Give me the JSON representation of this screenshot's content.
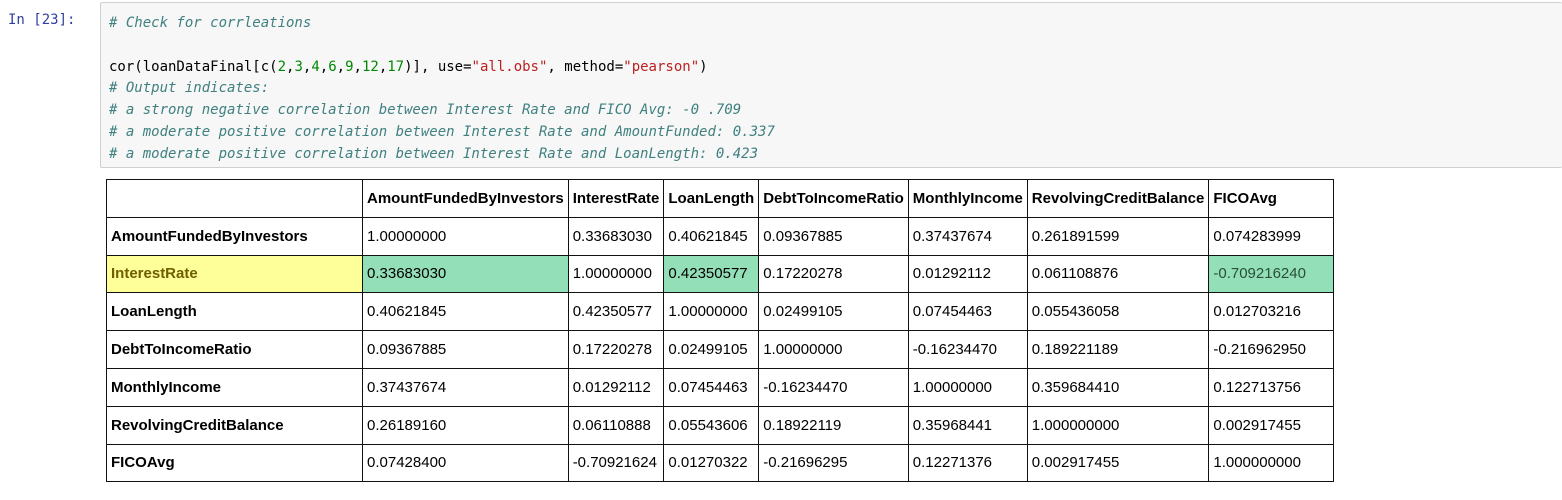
{
  "cell": {
    "prompt": "In [23]:",
    "code": {
      "comment_header": "# Check for corrleations",
      "call_prefix": "cor(loanDataFinal[c(",
      "call_nums": [
        "2",
        "3",
        "4",
        "6",
        "9",
        "12",
        "17"
      ],
      "call_mid1": ")], use=",
      "use_value": "\"all.obs\"",
      "call_mid2": ", method=",
      "method_value": "\"pearson\"",
      "call_suffix": ")",
      "comments": [
        "# Output indicates:",
        "# a strong negative correlation between Interest Rate and FICO Avg: -0 .709",
        "# a moderate positive correlation between Interest Rate and AmountFunded: 0.337",
        "# a moderate positive correlation between Interest Rate and LoanLength: 0.423"
      ]
    }
  },
  "table": {
    "columns": [
      "",
      "AmountFundedByInvestors",
      "InterestRate",
      "LoanLength",
      "DebtToIncomeRatio",
      "MonthlyIncome",
      "RevolvingCreditBalance",
      "FICOAvg"
    ],
    "rows": [
      {
        "label": "AmountFundedByInvestors",
        "cells": [
          "1.00000000",
          "0.33683030",
          "0.40621845",
          "0.09367885",
          "0.37437674",
          "0.261891599",
          "0.074283999"
        ]
      },
      {
        "label": "InterestRate",
        "cells": [
          "0.33683030",
          "1.00000000",
          "0.42350577",
          "0.17220278",
          "0.01292112",
          "0.061108876",
          "-0.709216240"
        ]
      },
      {
        "label": "LoanLength",
        "cells": [
          "0.40621845",
          "0.42350577",
          "1.00000000",
          "0.02499105",
          "0.07454463",
          "0.055436058",
          "0.012703216"
        ]
      },
      {
        "label": "DebtToIncomeRatio",
        "cells": [
          "0.09367885",
          "0.17220278",
          "0.02499105",
          "1.00000000",
          "-0.16234470",
          "0.189221189",
          "-0.216962950"
        ]
      },
      {
        "label": "MonthlyIncome",
        "cells": [
          "0.37437674",
          "0.01292112",
          "0.07454463",
          "-0.16234470",
          "1.00000000",
          "0.359684410",
          "0.122713756"
        ]
      },
      {
        "label": "RevolvingCreditBalance",
        "cells": [
          "0.26189160",
          "0.06110888",
          "0.05543606",
          "0.18922119",
          "0.35968441",
          "1.000000000",
          "0.002917455"
        ]
      },
      {
        "label": "FICOAvg",
        "cells": [
          "0.07428400",
          "-0.70921624",
          "0.01270322",
          "-0.21696295",
          "0.12271376",
          "0.002917455",
          "1.000000000"
        ]
      }
    ],
    "highlights": {
      "yellow_row_label": "InterestRate",
      "yellow_color": "#ffff99",
      "green_color": "#93dfb8",
      "green_cells": [
        [
          1,
          0
        ],
        [
          1,
          2
        ],
        [
          1,
          6
        ]
      ]
    }
  }
}
